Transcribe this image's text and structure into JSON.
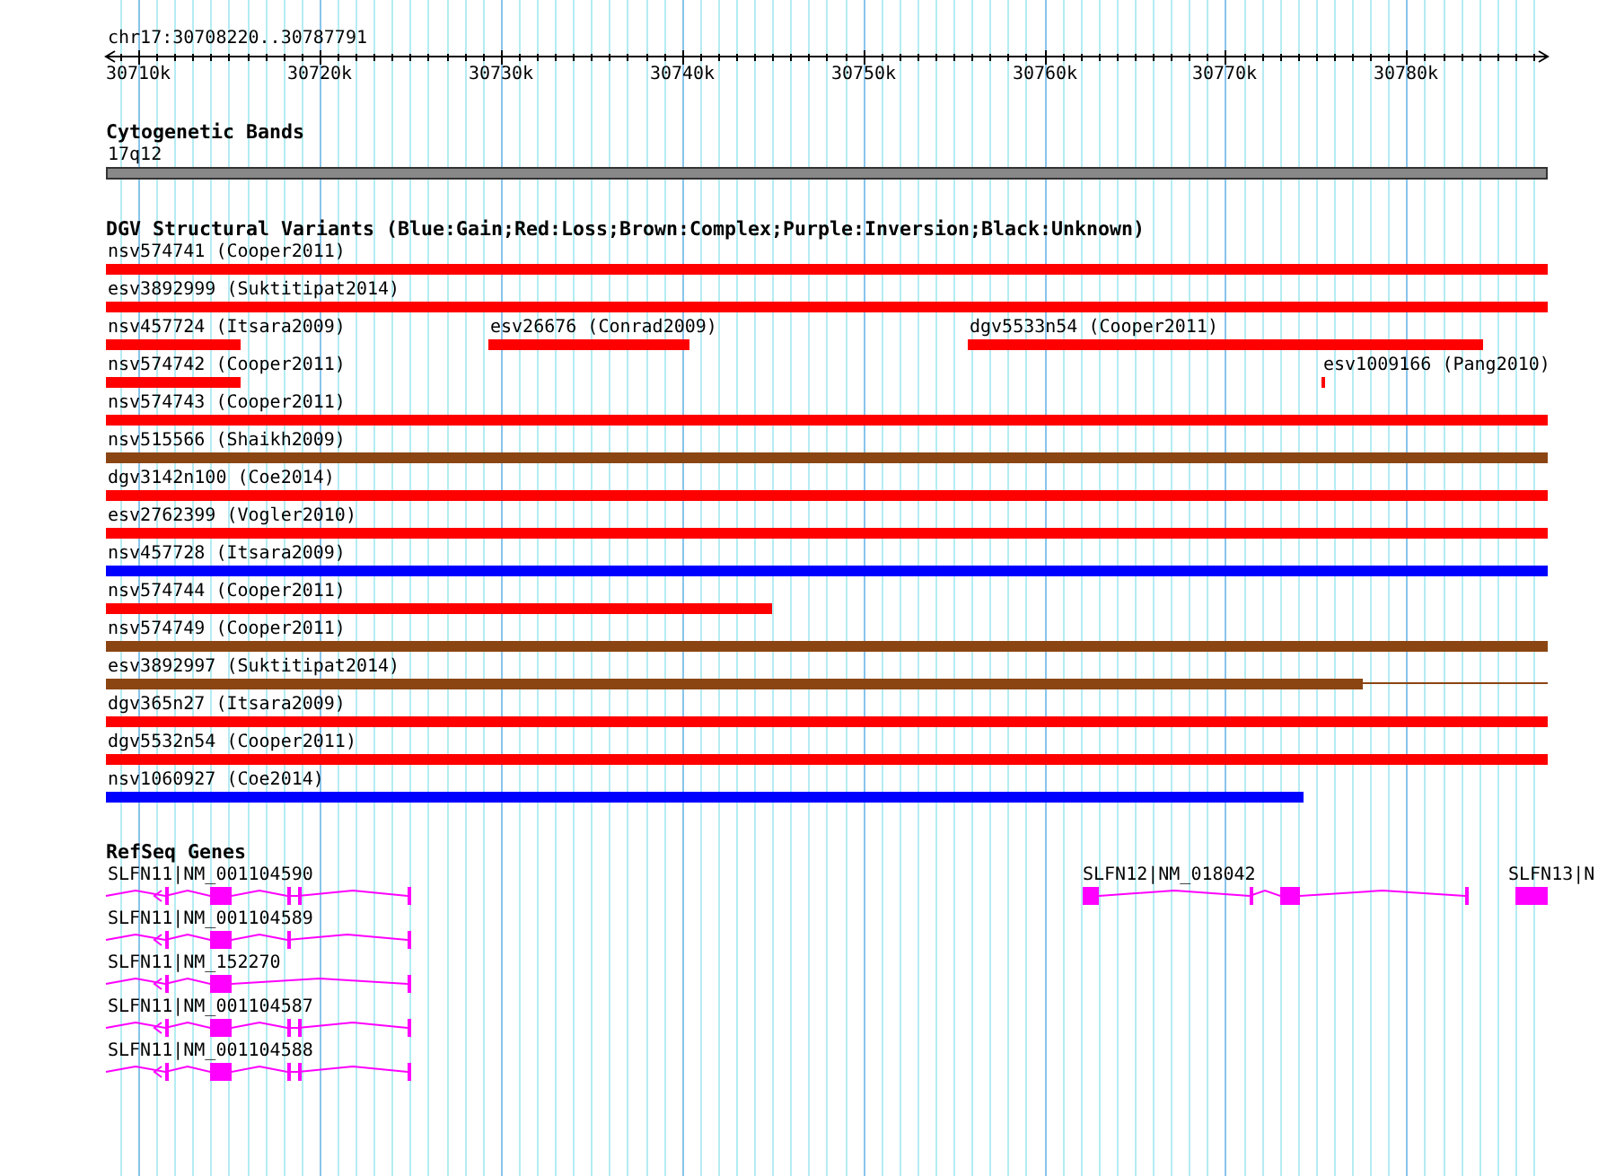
{
  "ruler": {
    "region": "chr17:30708220..30787791",
    "ticks": [
      "30710k",
      "30720k",
      "30730k",
      "30740k",
      "30750k",
      "30760k",
      "30770k",
      "30780k"
    ]
  },
  "cytogenetic_track": {
    "title": "Cytogenetic Bands",
    "bands": [
      {
        "label": "17q12"
      }
    ]
  },
  "variant_track": {
    "title": "DGV Structural Variants (Blue:Gain;Red:Loss;Brown:Complex;Purple:Inversion;Black:Unknown)",
    "rows": [
      {
        "features": [
          {
            "label": "nsv574741 (Cooper2011)",
            "color": "#ff0000"
          }
        ]
      },
      {
        "features": [
          {
            "label": "esv3892999 (Suktitipat2014)",
            "color": "#ff0000"
          }
        ]
      },
      {
        "features": [
          {
            "label": "nsv457724 (Itsara2009)",
            "color": "#ff0000"
          },
          {
            "label": "esv26676 (Conrad2009)",
            "color": "#ff0000"
          },
          {
            "label": "dgv5533n54 (Cooper2011)",
            "color": "#ff0000"
          }
        ]
      },
      {
        "features": [
          {
            "label": "nsv574742 (Cooper2011)",
            "color": "#ff0000"
          },
          {
            "label": "esv1009166 (Pang2010)",
            "color": "#ff0000"
          }
        ]
      },
      {
        "features": [
          {
            "label": "nsv574743 (Cooper2011)",
            "color": "#ff0000"
          }
        ]
      },
      {
        "features": [
          {
            "label": "nsv515566 (Shaikh2009)",
            "color": "#8b4513"
          }
        ]
      },
      {
        "features": [
          {
            "label": "dgv3142n100 (Coe2014)",
            "color": "#ff0000"
          }
        ]
      },
      {
        "features": [
          {
            "label": "esv2762399 (Vogler2010)",
            "color": "#ff0000"
          }
        ]
      },
      {
        "features": [
          {
            "label": "nsv457728 (Itsara2009)",
            "color": "#0000ff"
          }
        ]
      },
      {
        "features": [
          {
            "label": "nsv574744 (Cooper2011)",
            "color": "#ff0000"
          }
        ]
      },
      {
        "features": [
          {
            "label": "nsv574749 (Cooper2011)",
            "color": "#8b4513"
          }
        ]
      },
      {
        "features": [
          {
            "label": "esv3892997 (Suktitipat2014)",
            "color": "#8b4513"
          }
        ]
      },
      {
        "features": [
          {
            "label": "dgv365n27 (Itsara2009)",
            "color": "#ff0000"
          }
        ]
      },
      {
        "features": [
          {
            "label": "dgv5532n54 (Cooper2011)",
            "color": "#ff0000"
          }
        ]
      },
      {
        "features": [
          {
            "label": "nsv1060927 (Coe2014)",
            "color": "#0000ff"
          }
        ]
      }
    ]
  },
  "gene_track": {
    "title": "RefSeq Genes",
    "rows": [
      {
        "genes": [
          {
            "label": "SLFN11|NM_001104590"
          },
          {
            "label": "SLFN12|NM_018042"
          },
          {
            "label": "SLFN13|N"
          }
        ]
      },
      {
        "genes": [
          {
            "label": "SLFN11|NM_001104589"
          }
        ]
      },
      {
        "genes": [
          {
            "label": "SLFN11|NM_152270"
          }
        ]
      },
      {
        "genes": [
          {
            "label": "SLFN11|NM_001104587"
          }
        ]
      },
      {
        "genes": [
          {
            "label": "SLFN11|NM_001104588"
          }
        ]
      }
    ]
  }
}
